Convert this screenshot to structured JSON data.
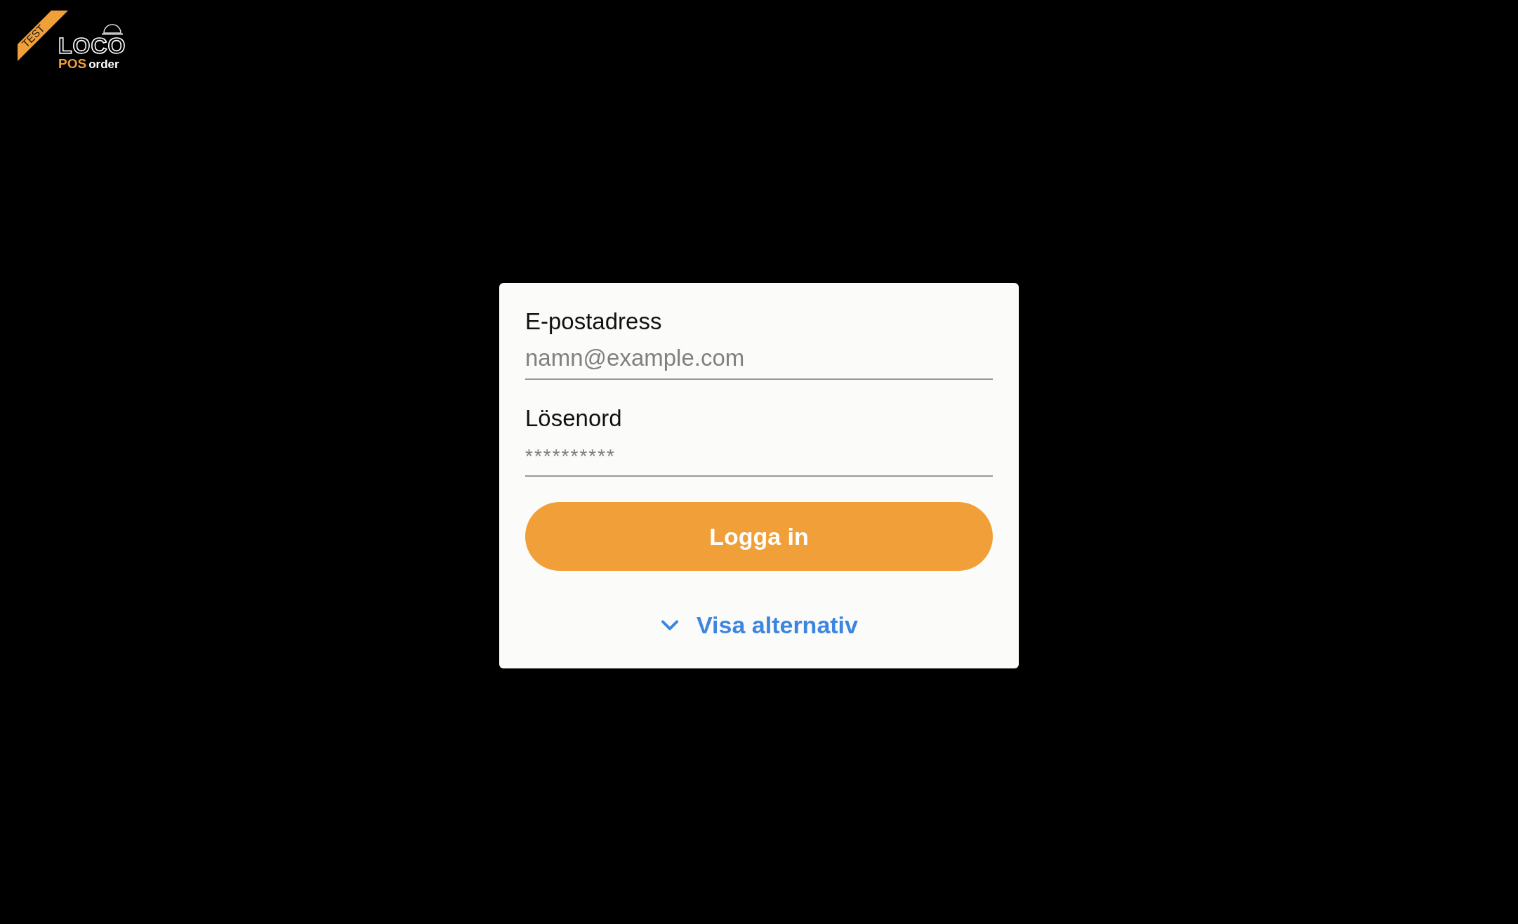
{
  "logo": {
    "badge": "TEST",
    "name": "LOCO",
    "name_accent": "POS",
    "name_suffix": "order"
  },
  "form": {
    "fields": [
      {
        "label": "E-postadress",
        "placeholder": "namn@example.com",
        "kind": "email"
      },
      {
        "label": "Lösenord",
        "placeholder": "**********",
        "kind": "password"
      }
    ],
    "submit": "Logga in",
    "options_link": {
      "label": "Visa alternativ",
      "expanded": false
    }
  }
}
